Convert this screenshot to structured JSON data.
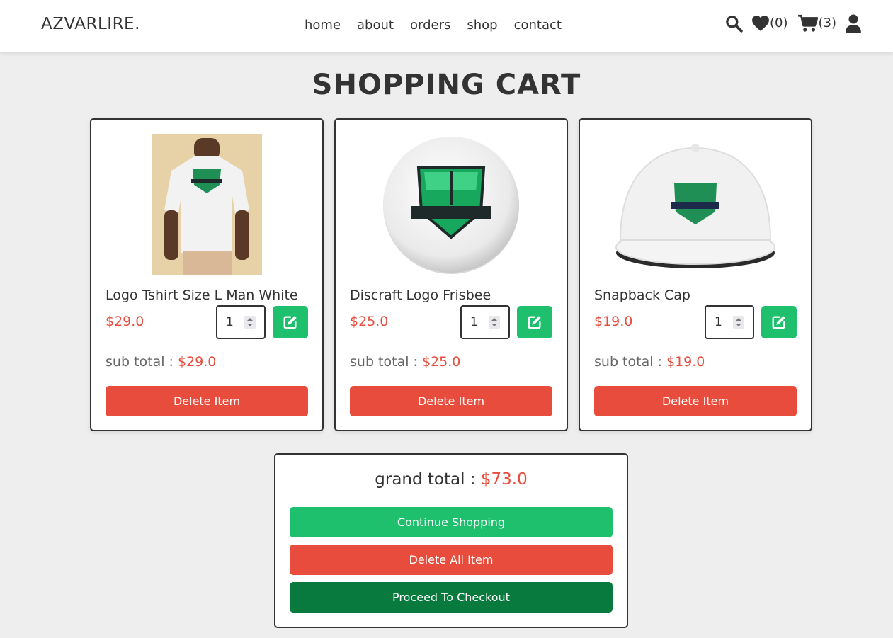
{
  "header": {
    "logo": "AZVARLIRE.",
    "nav": [
      "home",
      "about",
      "orders",
      "shop",
      "contact"
    ],
    "icons": {
      "search": "search-icon",
      "wishlist": "heart-icon",
      "wishlist_count": "(0)",
      "cart": "cart-icon",
      "cart_count": "(3)",
      "user": "user-icon"
    }
  },
  "page_title": "SHOPPING CART",
  "items": [
    {
      "name": "Logo Tshirt Size L Man White",
      "price": "$29.0",
      "quantity": "1",
      "subtotal_label": "sub total :",
      "subtotal_value": "$29.0",
      "delete_label": "Delete Item",
      "image": "tshirt-product-image"
    },
    {
      "name": "Discraft Logo Frisbee",
      "price": "$25.0",
      "quantity": "1",
      "subtotal_label": "sub total :",
      "subtotal_value": "$25.0",
      "delete_label": "Delete Item",
      "image": "frisbee-product-image"
    },
    {
      "name": "Snapback Cap",
      "price": "$19.0",
      "quantity": "1",
      "subtotal_label": "sub total :",
      "subtotal_value": "$19.0",
      "delete_label": "Delete Item",
      "image": "cap-product-image"
    }
  ],
  "summary": {
    "grand_total_label": "grand total :",
    "grand_total_value": "$73.0",
    "continue_label": "Continue Shopping",
    "delete_all_label": "Delete All Item",
    "checkout_label": "Proceed To Checkout"
  },
  "colors": {
    "accent_red": "#e74c3c",
    "accent_green": "#1ec06e",
    "dark_green": "#087a3e",
    "text": "#333333",
    "background": "#eeeeee"
  }
}
